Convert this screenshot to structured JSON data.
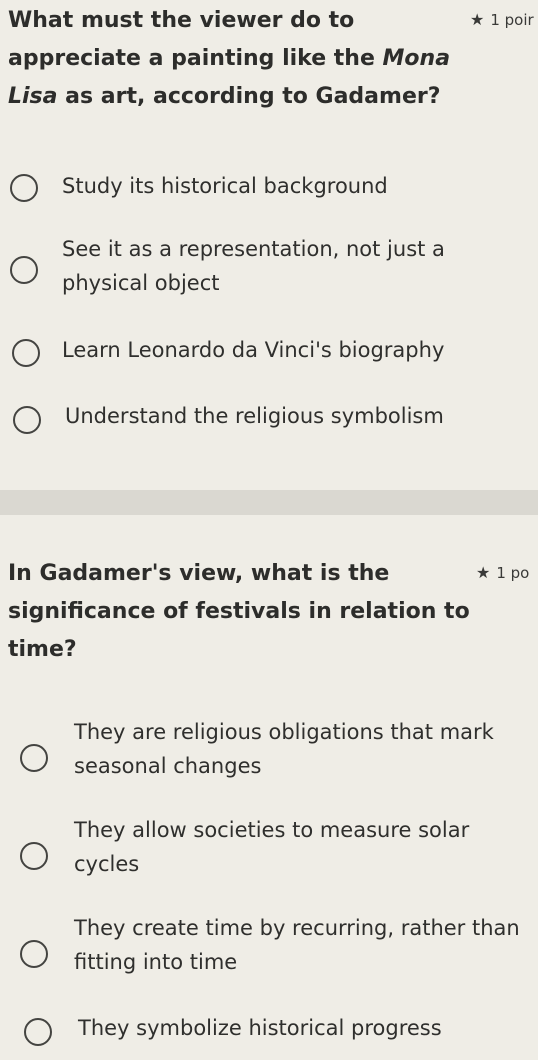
{
  "questions": [
    {
      "text_line1": "What must the viewer do to",
      "text_line2": "appreciate a painting like the ",
      "text_italic_a": "Mona",
      "text_italic_b": "Lisa",
      "text_line3_rest": " as art, according to Gadamer?",
      "points": "1 poir",
      "options": [
        {
          "label": "Study its historical background"
        },
        {
          "label_line1": "See it as a representation, not just a",
          "label_line2": "physical object"
        },
        {
          "label": "Learn Leonardo da Vinci's biography"
        },
        {
          "label": "Understand the religious symbolism"
        }
      ]
    },
    {
      "text_line1": "In Gadamer's view, what is the",
      "text_line2": "significance of festivals in relation to",
      "text_line3": "time?",
      "points": "1 po",
      "options": [
        {
          "label_line1": "They are religious obligations that mark",
          "label_line2": "seasonal changes"
        },
        {
          "label_line1": "They allow societies to measure solar",
          "label_line2": "cycles"
        },
        {
          "label_line1": "They create time by recurring, rather than",
          "label_line2": "fitting into time"
        },
        {
          "label": "They symbolize historical progress"
        }
      ]
    }
  ],
  "icons": {
    "star": "★",
    "radio": "radio-unchecked-icon"
  }
}
